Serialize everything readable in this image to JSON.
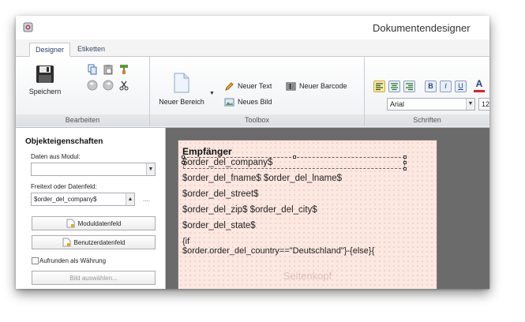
{
  "window": {
    "title": "Dokumentendesigner"
  },
  "tabs": [
    {
      "label": "Designer"
    },
    {
      "label": "Etiketten"
    }
  ],
  "ribbon": {
    "bearbeiten": {
      "group_label": "Bearbeiten",
      "save_label": "Speichern"
    },
    "toolbox": {
      "group_label": "Toolbox",
      "new_area_label": "Neuer Bereich",
      "new_text_label": "Neuer Text",
      "new_barcode_label": "Neuer Barcode",
      "new_image_label": "Neues Bild"
    },
    "schriften": {
      "group_label": "Schriften",
      "font_name": "Arial",
      "font_size": "12",
      "bold_label": "B",
      "italic_label": "I",
      "underline_label": "U",
      "font_color_label": "A"
    }
  },
  "properties_panel": {
    "title": "Objekteigenschaften",
    "data_from_module_label": "Daten aus Modul:",
    "data_from_module_value": "",
    "freetext_label": "Freitext oder Datenfeld:",
    "freetext_value": "$order_del_company$",
    "ellipsis": "....",
    "module_field_button": "Moduldatenfeld",
    "user_field_button": "Benutzerdatenfeld",
    "round_currency_label": "Aufrunden als Währung",
    "select_image_button": "Bild auswählen..."
  },
  "document": {
    "title": "Empfänger",
    "fields": [
      "$order_del_company$",
      "$order_del_fname$ $order_del_lname$",
      "$order_del_street$",
      "$order_del_zip$ $order_del_city$",
      "$order_del_state$",
      "{if",
      "$order.order_del_country==\"Deutschland\"}-{else}{"
    ],
    "section_label": "Seitenkopf"
  },
  "colors": {
    "paper": "#fde7e1",
    "canvas_background": "#6b6b6b",
    "accent_blue": "#2a3f63"
  }
}
